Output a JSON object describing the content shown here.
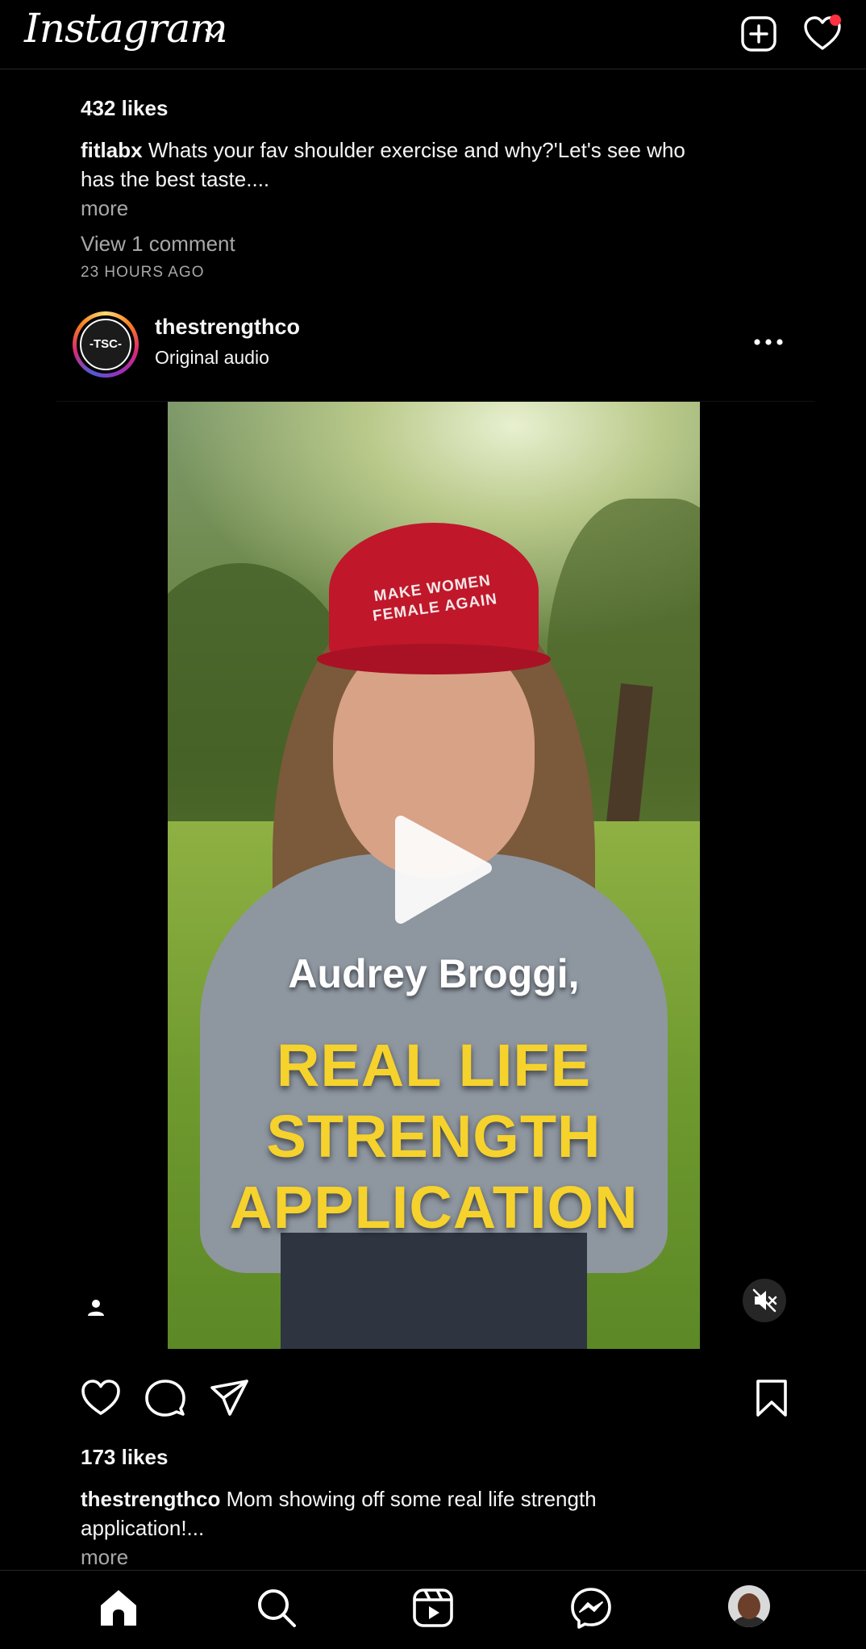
{
  "header": {
    "app_name": "Instagram",
    "icons": [
      "chevron-down-icon",
      "new-post-icon",
      "heart-icon"
    ],
    "notification_dot_color": "#ff3040"
  },
  "previous_post": {
    "likes": "432 likes",
    "username": "fitlabx",
    "caption_line1": "Whats your fav shoulder exercise and why?'Let's see who",
    "caption_line2": "has the best taste....",
    "more": "more",
    "view_comments": "View 1 comment",
    "time_ago": "23 HOURS AGO"
  },
  "post": {
    "username": "thestrengthco",
    "audio": "Original audio",
    "avatar_text": "-TSC-",
    "video": {
      "hat_text_line1": "MAKE WOMEN",
      "hat_text_line2": "FEMALE AGAIN",
      "overlay_name": "Audrey Broggi,",
      "overlay_line1": "REAL LIFE",
      "overlay_line2": "STRENGTH",
      "overlay_line3": "APPLICATION"
    },
    "likes": "173 likes",
    "caption_username": "thestrengthco",
    "caption_line1": "Mom showing off some real life strength",
    "caption_line2": "application!...",
    "more": "more"
  },
  "bottom_nav": {
    "items": [
      "home-icon",
      "search-icon",
      "reels-icon",
      "messenger-icon",
      "profile-avatar"
    ]
  }
}
